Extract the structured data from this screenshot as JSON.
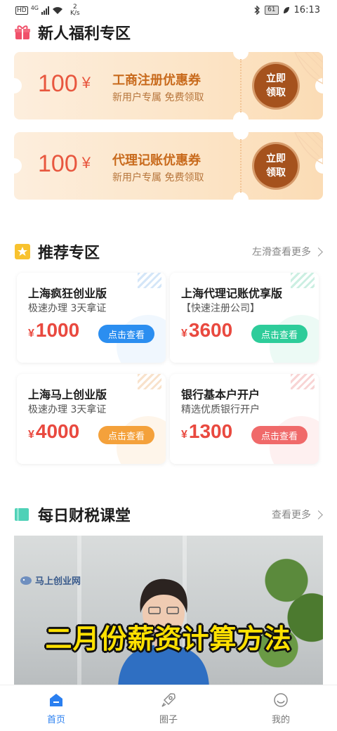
{
  "status_bar": {
    "hd": "HD",
    "net": "4G",
    "speed_value": "2",
    "speed_unit": "K/s",
    "battery": "61",
    "time": "16:13"
  },
  "welfare": {
    "title": "新人福利专区",
    "coupons": [
      {
        "amount": "100",
        "currency": "¥",
        "title": "工商注册优惠券",
        "subtitle": "新用户专属 免费领取",
        "claim_line1": "立即",
        "claim_line2": "领取"
      },
      {
        "amount": "100",
        "currency": "¥",
        "title": "代理记账优惠券",
        "subtitle": "新用户专属 免费领取",
        "claim_line1": "立即",
        "claim_line2": "领取"
      }
    ]
  },
  "recommend": {
    "title": "推荐专区",
    "more": "左滑查看更多",
    "products": [
      {
        "title": "上海疯狂创业版",
        "subtitle": "极速办理 3天拿证",
        "currency": "¥",
        "price": "1000",
        "button": "点击查看",
        "color": "#2b8ef0"
      },
      {
        "title": "上海代理记账优享版",
        "subtitle": "【快速注册公司】",
        "currency": "¥",
        "price": "3600",
        "button": "点击查看",
        "color": "#2ecc9a"
      },
      {
        "title": "上海马上创业版",
        "subtitle": "极速办理 3天拿证",
        "currency": "¥",
        "price": "4000",
        "button": "点击查看",
        "color": "#f4a13b"
      },
      {
        "title": "银行基本户开户",
        "subtitle": "精选优质银行开户",
        "currency": "¥",
        "price": "1300",
        "button": "点击查看",
        "color": "#f06a6a"
      }
    ]
  },
  "classroom": {
    "title": "每日财税课堂",
    "more": "查看更多",
    "video": {
      "caption": "二月份薪资计算方法",
      "watermark": "马上创业网"
    }
  },
  "tabbar": {
    "items": [
      {
        "label": "首页",
        "icon": "home-icon",
        "active": true
      },
      {
        "label": "圈子",
        "icon": "rocket-icon",
        "active": false
      },
      {
        "label": "我的",
        "icon": "face-icon",
        "active": false
      }
    ]
  },
  "colors": {
    "accent": "#2a7ff0",
    "coupon_text": "#c86a1c",
    "price_red": "#e9493f",
    "claim_button": "#a5521d"
  }
}
